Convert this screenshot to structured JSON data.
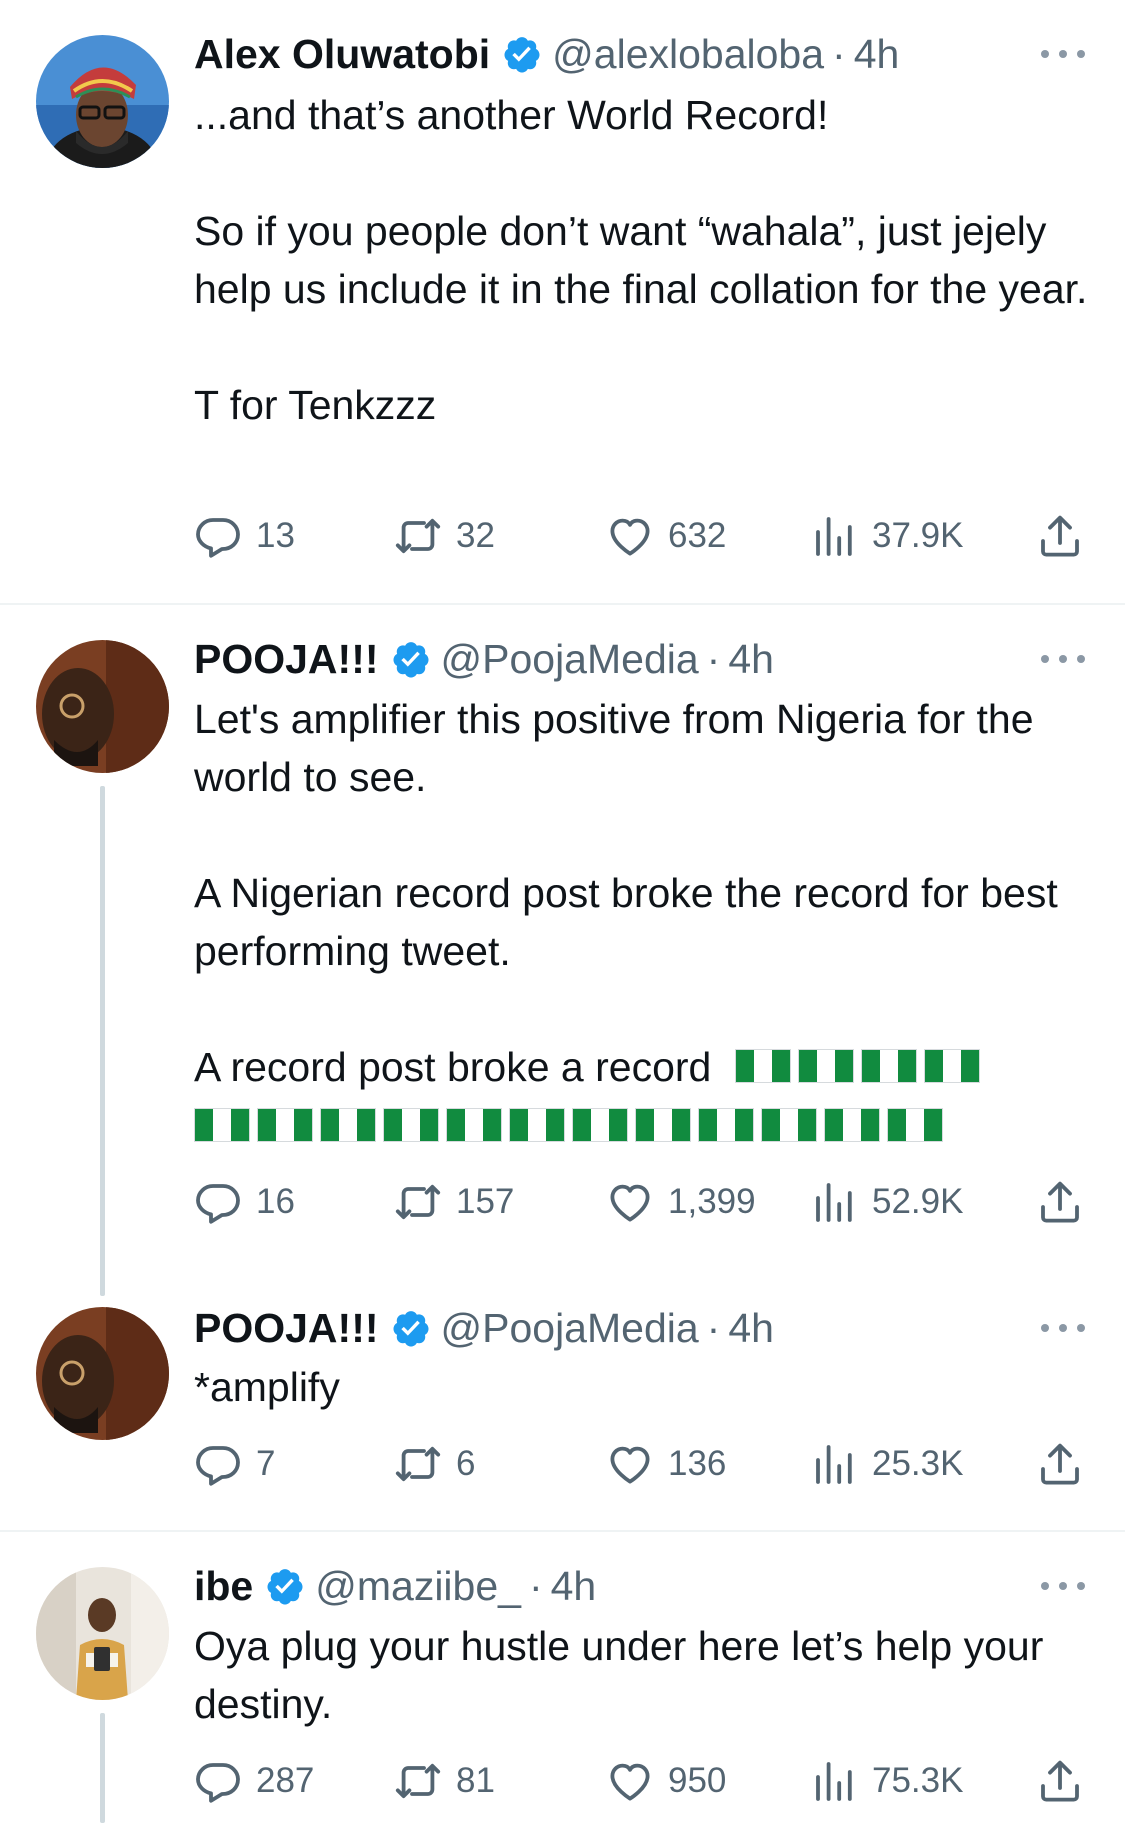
{
  "colors": {
    "verified": "#1d9bf0",
    "muted": "#536471",
    "text": "#0f1419",
    "flag_green": "#118b3f"
  },
  "tweets": [
    {
      "name": "Alex Oluwatobi",
      "handle": "@alexlobaloba",
      "time": "4h",
      "paragraphs": [
        "...and that’s another World Record!",
        "So if you people don’t want “wahala”, just jejely help us include it in the final collation for the year.",
        "T for Tenkzzz"
      ],
      "replies": "13",
      "retweets": "32",
      "likes": "632",
      "views": "37.9K"
    },
    {
      "name": "POOJA!!!",
      "handle": "@PoojaMedia",
      "time": "4h",
      "paragraphs": [
        "Let's amplifier this positive from Nigeria for the world to see.",
        "A Nigerian record post broke the record for best performing tweet.",
        "A record post broke a record"
      ],
      "flag_icon": "nigeria-flag-emoji",
      "replies": "16",
      "retweets": "157",
      "likes": "1,399",
      "views": "52.9K"
    },
    {
      "name": "POOJA!!!",
      "handle": "@PoojaMedia",
      "time": "4h",
      "paragraphs": [
        "*amplify"
      ],
      "replies": "7",
      "retweets": "6",
      "likes": "136",
      "views": "25.3K"
    },
    {
      "name": "ibe",
      "handle": "@maziibe_",
      "time": "4h",
      "paragraphs": [
        "Oya plug your hustle under here let’s help your destiny."
      ],
      "replies": "287",
      "retweets": "81",
      "likes": "950",
      "views": "75.3K"
    }
  ]
}
